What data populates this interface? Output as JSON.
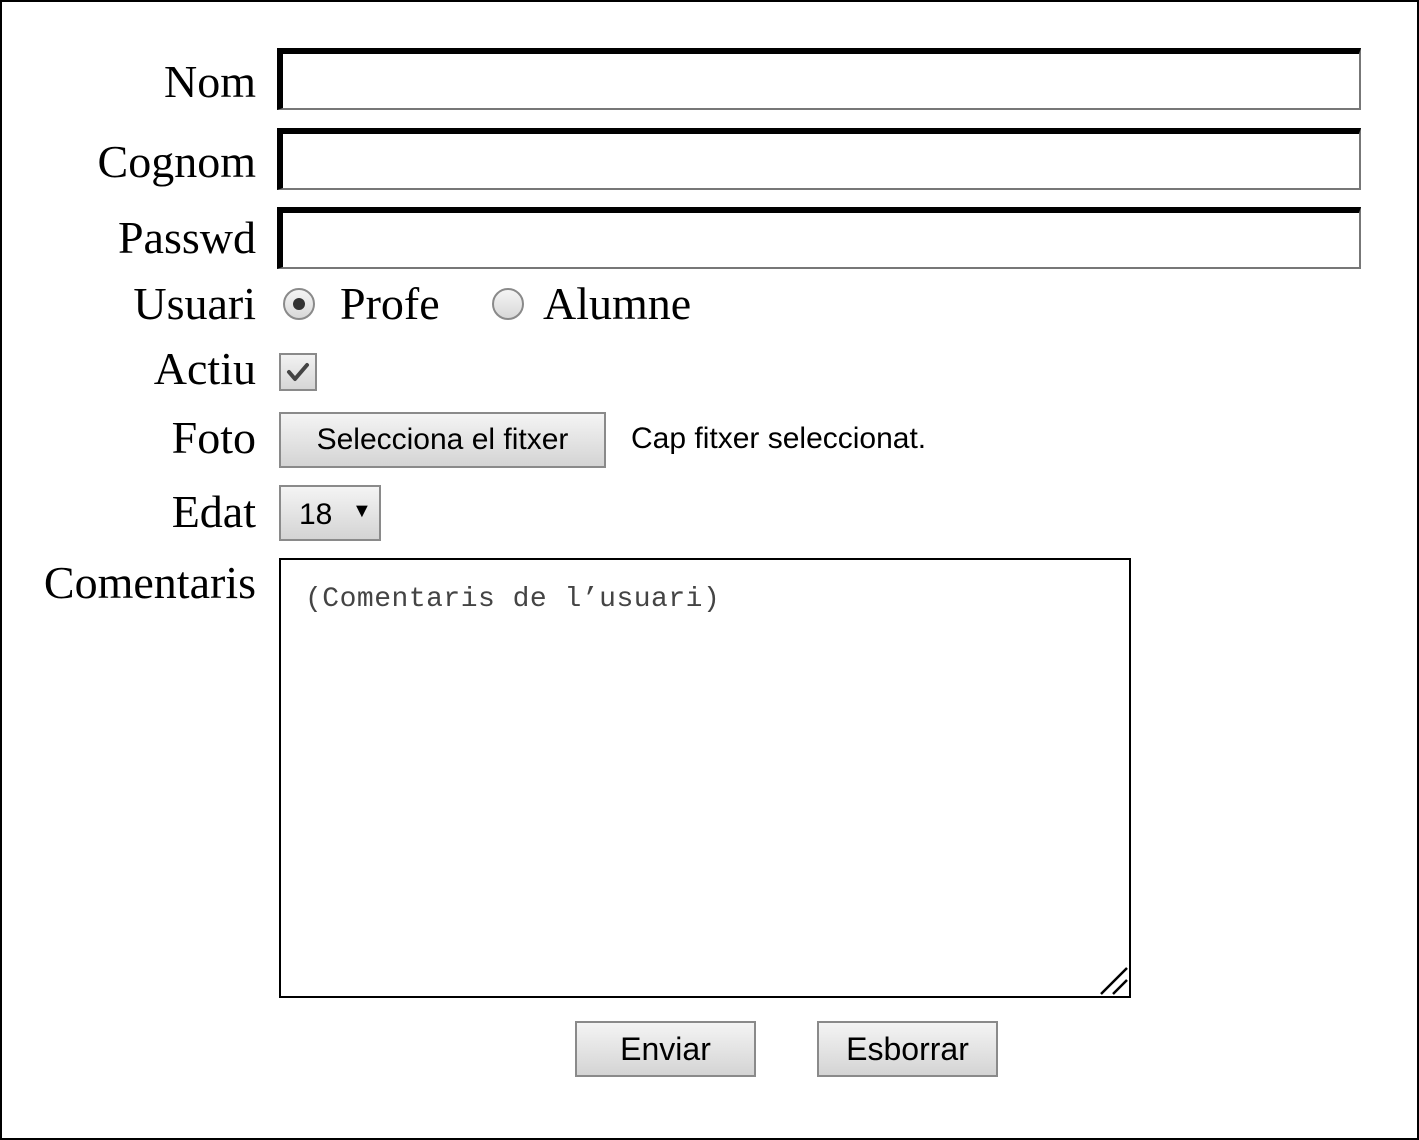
{
  "form": {
    "fields": {
      "nom": {
        "label": "Nom",
        "value": ""
      },
      "cognom": {
        "label": "Cognom",
        "value": ""
      },
      "passwd": {
        "label": "Passwd",
        "value": ""
      }
    },
    "usuari": {
      "label": "Usuari",
      "options": [
        "Profe",
        "Alumne"
      ],
      "selected": "Profe"
    },
    "actiu": {
      "label": "Actiu",
      "checked": true
    },
    "foto": {
      "label": "Foto",
      "button_label": "Selecciona el fitxer",
      "status": "Cap fitxer seleccionat."
    },
    "edat": {
      "label": "Edat",
      "value": "18"
    },
    "comentaris": {
      "label": "Comentaris",
      "placeholder": "(Comentaris de l’usuari)"
    },
    "buttons": {
      "submit": "Enviar",
      "reset": "Esborrar"
    }
  },
  "icons": {
    "select_arrow": "▼",
    "checkbox": "checkmark-icon",
    "textarea_resize": "resize-grip-icon"
  }
}
